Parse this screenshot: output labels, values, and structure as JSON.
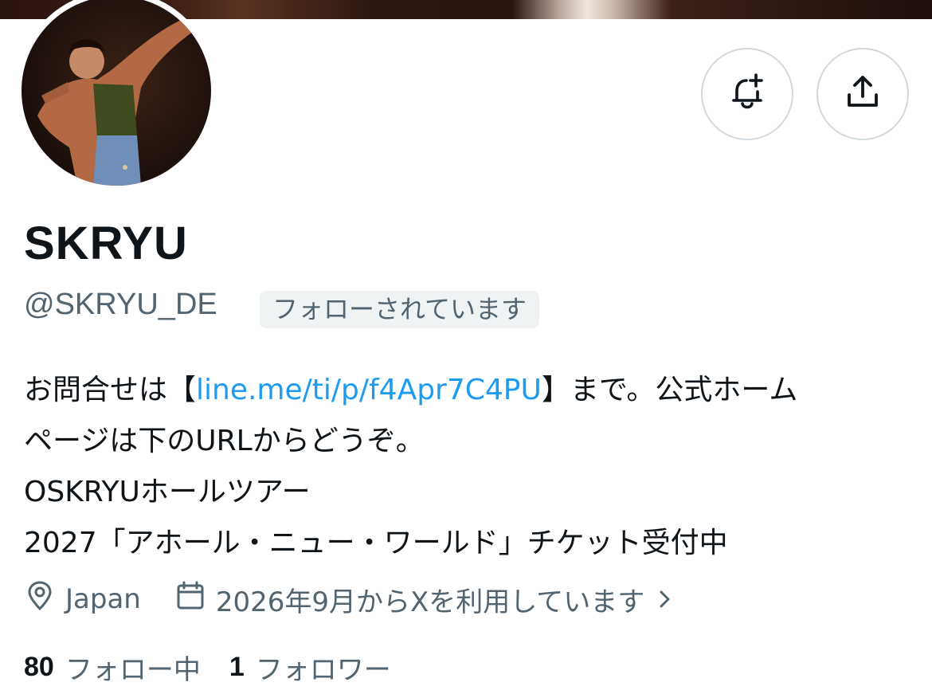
{
  "profile": {
    "display_name": "SKRYU",
    "handle": "@SKRYU_DE",
    "follows_you_badge": "フォローされています"
  },
  "bio": {
    "line1_prefix": "お問合せは【",
    "line1_link": "line.me/ti/p/f4Apr7C4PU",
    "line1_suffix": "】まで。公式ホーム",
    "line2": "ページは下のURLからどうぞ。",
    "line3": "OSKRYUホールツアー",
    "line4": "2027「アホール・ニュー・ワールド」チケット受付中"
  },
  "meta": {
    "location": "Japan",
    "joined": "2026年9月からXを利用しています"
  },
  "stats": {
    "following_count": "80",
    "following_label": "フォロー中",
    "followers_count": "1",
    "followers_label": "フォロワー"
  },
  "icons": {
    "notifications": "bell-plus-icon",
    "share": "share-icon",
    "location": "location-pin-icon",
    "joined": "calendar-icon",
    "expand": "chevron-right-icon"
  },
  "colors": {
    "link": "#1d9bf0",
    "secondary_text": "#536471",
    "primary_text": "#0f1419",
    "badge_bg": "#eff3f4",
    "button_border": "#d2d9de"
  }
}
